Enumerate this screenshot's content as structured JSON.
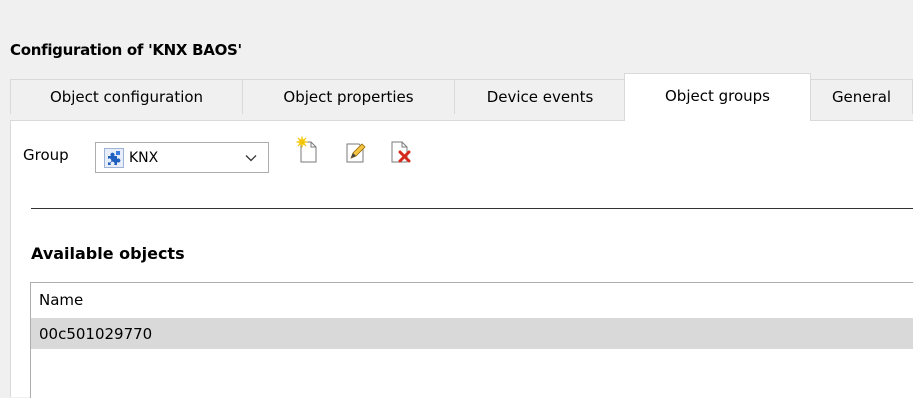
{
  "window": {
    "title": "Configuration of 'KNX BAOS'"
  },
  "tabs": [
    {
      "label": "Object configuration"
    },
    {
      "label": "Object properties"
    },
    {
      "label": "Device events"
    },
    {
      "label": "Object groups",
      "active": true
    },
    {
      "label": "General"
    }
  ],
  "group": {
    "label": "Group",
    "selected_value": "KNX",
    "icon": "puzzle-icon"
  },
  "toolbar": {
    "new_icon": "new-document-icon",
    "edit_icon": "edit-document-icon",
    "delete_icon": "delete-document-icon"
  },
  "available_objects": {
    "title": "Available objects",
    "columns": [
      "Name"
    ],
    "rows": [
      {
        "name": "00c501029770"
      }
    ]
  },
  "colors": {
    "background": "#f0f0f0",
    "selected_row": "#d9d9d9",
    "puzzle_blue": "#1f5fbf",
    "delete_red": "#d42a1c"
  }
}
